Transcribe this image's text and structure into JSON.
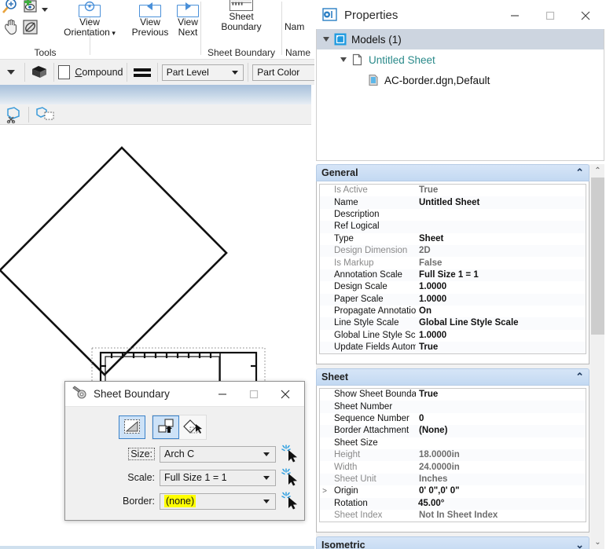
{
  "ribbon": {
    "groups": [
      {
        "label": "Tools"
      },
      {
        "label": "Sheet Boundary"
      },
      {
        "label": "Name"
      }
    ],
    "buttons": [
      {
        "name": "view-orientation",
        "line1": "View",
        "line2": "Orientation",
        "has_menu": true
      },
      {
        "name": "view-previous",
        "line1": "View",
        "line2": "Previous",
        "has_menu": false
      },
      {
        "name": "view-next",
        "line1": "View",
        "line2": "Next",
        "has_menu": false
      },
      {
        "name": "sheet-boundary",
        "line1": "Sheet",
        "line2": "Boundary",
        "has_menu": false
      },
      {
        "name": "name",
        "line1": "Nam",
        "line2": "",
        "has_menu": false
      }
    ],
    "tool_icons": [
      "zoom-icon",
      "add-view-icon",
      "pan-hand-icon",
      "clip-volume-icon",
      "dropdown-arrow-icon"
    ]
  },
  "attrbar": {
    "compound_label": "Compound",
    "part_level": "Part Level",
    "part_color": "Part Color",
    "icons": [
      "level-dropdown-icon",
      "stack-icon",
      "line-weight-icon"
    ]
  },
  "view_toolbar": {
    "icons": [
      "clip-volume-cut-icon",
      "clip-mask-icon"
    ]
  },
  "canvas": {
    "description": "CAD sheet border drawing with rotated sheet boundary outline at 45 degrees",
    "elements": [
      "rotated-sheet-boundary-diamond",
      "sheet-border-rectangle",
      "title-block",
      "tick-marks-ruler",
      "arrow-handles",
      "red-origin-marker"
    ]
  },
  "properties": {
    "title": "Properties",
    "window_buttons": {
      "minimize": "—",
      "maximize": "□",
      "close": "✕"
    },
    "tree": [
      {
        "label": "Models (1)",
        "icon": "models-cube-icon",
        "depth": 0,
        "selected": true,
        "expander": "down"
      },
      {
        "label": "Untitled Sheet",
        "icon": "sheet-page-icon",
        "depth": 1,
        "selected": false,
        "expander": "down"
      },
      {
        "label": "AC-border.dgn,Default",
        "icon": "reference-file-icon",
        "depth": 2,
        "selected": false,
        "expander": "none"
      }
    ],
    "sections": [
      {
        "name": "general",
        "title": "General",
        "collapsed": false,
        "rows": [
          {
            "key": "Is Active",
            "value": "True",
            "key_dim": true,
            "value_dim": true,
            "highlight": false,
            "expandable": false
          },
          {
            "key": "Name",
            "value": "Untitled Sheet",
            "key_dim": false,
            "value_dim": false,
            "highlight": false,
            "expandable": false
          },
          {
            "key": "Description",
            "value": "",
            "key_dim": false,
            "value_dim": false,
            "highlight": false,
            "expandable": false
          },
          {
            "key": "Ref Logical",
            "value": "",
            "key_dim": false,
            "value_dim": false,
            "highlight": false,
            "expandable": false
          },
          {
            "key": "Type",
            "value": "Sheet",
            "key_dim": false,
            "value_dim": false,
            "highlight": false,
            "expandable": false
          },
          {
            "key": "Design Dimension",
            "value": "2D",
            "key_dim": true,
            "value_dim": true,
            "highlight": false,
            "expandable": false
          },
          {
            "key": "Is Markup",
            "value": "False",
            "key_dim": true,
            "value_dim": true,
            "highlight": false,
            "expandable": false
          },
          {
            "key": "Annotation Scale",
            "value": "Full Size 1 = 1",
            "key_dim": false,
            "value_dim": false,
            "highlight": false,
            "expandable": false
          },
          {
            "key": "Design Scale",
            "value": "1.0000",
            "key_dim": false,
            "value_dim": false,
            "highlight": false,
            "expandable": false
          },
          {
            "key": "Paper Scale",
            "value": "1.0000",
            "key_dim": false,
            "value_dim": false,
            "highlight": false,
            "expandable": false
          },
          {
            "key": "Propagate Annotation",
            "value": "On",
            "key_dim": false,
            "value_dim": false,
            "highlight": false,
            "expandable": false
          },
          {
            "key": "Line Style Scale",
            "value": "Global Line Style Scale",
            "key_dim": false,
            "value_dim": false,
            "highlight": false,
            "expandable": false
          },
          {
            "key": "Global Line Style Sca",
            "value": "1.0000",
            "key_dim": false,
            "value_dim": false,
            "highlight": false,
            "expandable": false
          },
          {
            "key": "Update Fields Autom",
            "value": "True",
            "key_dim": false,
            "value_dim": false,
            "highlight": false,
            "expandable": false
          }
        ]
      },
      {
        "name": "sheet",
        "title": "Sheet",
        "collapsed": false,
        "rows": [
          {
            "key": "Show Sheet Boundar",
            "value": "True",
            "key_dim": false,
            "value_dim": false,
            "highlight": false,
            "expandable": false
          },
          {
            "key": "Sheet Number",
            "value": "",
            "key_dim": false,
            "value_dim": false,
            "highlight": false,
            "expandable": false
          },
          {
            "key": "Sequence Number",
            "value": "0",
            "key_dim": false,
            "value_dim": false,
            "highlight": false,
            "expandable": false
          },
          {
            "key": "Border Attachment",
            "value": "(None)",
            "key_dim": false,
            "value_dim": false,
            "highlight": false,
            "expandable": false
          },
          {
            "key": "Sheet Size",
            "value": "",
            "key_dim": false,
            "value_dim": false,
            "highlight": false,
            "expandable": false
          },
          {
            "key": "Height",
            "value": "18.0000in",
            "key_dim": true,
            "value_dim": true,
            "highlight": false,
            "expandable": false
          },
          {
            "key": "Width",
            "value": "24.0000in",
            "key_dim": true,
            "value_dim": true,
            "highlight": false,
            "expandable": false
          },
          {
            "key": "Sheet Unit",
            "value": "Inches",
            "key_dim": true,
            "value_dim": true,
            "highlight": false,
            "expandable": false
          },
          {
            "key": "Origin",
            "value": "0' 0\",0' 0\"",
            "key_dim": false,
            "value_dim": false,
            "highlight": false,
            "expandable": true
          },
          {
            "key": "Rotation",
            "value": "45.00°",
            "key_dim": false,
            "value_dim": false,
            "highlight": true,
            "expandable": false
          },
          {
            "key": "Sheet Index",
            "value": "Not In Sheet Index",
            "key_dim": true,
            "value_dim": true,
            "highlight": false,
            "expandable": false
          }
        ]
      },
      {
        "name": "isometric",
        "title": "Isometric",
        "collapsed": true,
        "rows": []
      }
    ]
  },
  "sheet_boundary_dialog": {
    "title": "Sheet Boundary",
    "icon": "sheet-boundary-tool-icon",
    "window_buttons": {
      "minimize": "—",
      "maximize": "□",
      "close": "✕"
    },
    "mode_buttons": [
      {
        "name": "show-sheet-boundary-toggle",
        "selected": true,
        "icon": "boundary-outline-icon"
      },
      {
        "name": "place-boundary-mode",
        "selected": true,
        "icon": "place-boundary-icon"
      },
      {
        "name": "rotate-boundary-mode",
        "selected": false,
        "icon": "rotate-boundary-icon"
      }
    ],
    "fields": [
      {
        "name": "size",
        "label": "Size:",
        "value": "Arch C",
        "highlight": false,
        "label_boxed": true
      },
      {
        "name": "scale",
        "label": "Scale:",
        "value": "Full Size 1 = 1",
        "highlight": false,
        "label_boxed": false
      },
      {
        "name": "border",
        "label": "Border:",
        "value": "(none)",
        "highlight": true,
        "label_boxed": false
      }
    ],
    "pick_icon": "magic-wand-cursor-icon"
  },
  "colors": {
    "accent_blue": "#3a81c8",
    "section_header": "#c3d9f2",
    "tree_selection": "#cdd5e0",
    "highlight_yellow": "#ffff00",
    "tree_link_text": "#2a8a8a",
    "red_marker": "#e00000"
  }
}
